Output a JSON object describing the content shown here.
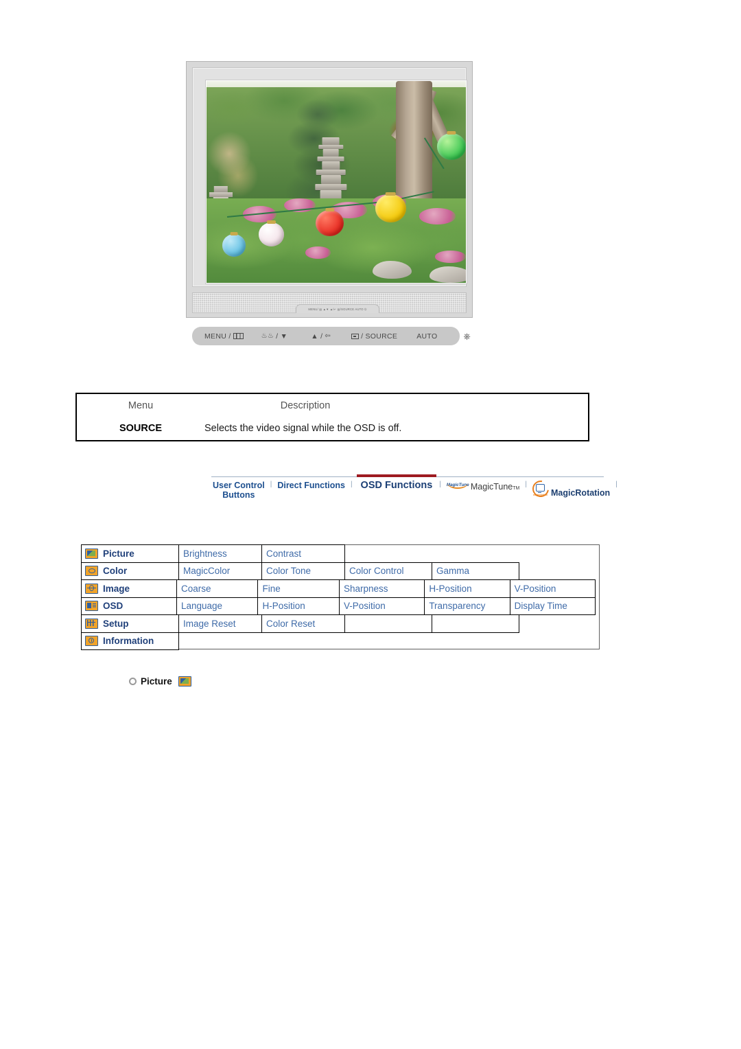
{
  "monitor": {
    "alt": "LCD monitor displaying a Korean temple garden with a stone pagoda and colorful paper lanterns",
    "base_strip_text": "MENU/ ▤  ▲▼  ▲/↵  ▤/SOURCE  AUTO  ⏻"
  },
  "buttons": [
    {
      "label": "MENU /",
      "icon": "menu-bars-icon"
    },
    {
      "label": "/ ▼",
      "icon": "magic-bright-icon"
    },
    {
      "label": "▲ /",
      "icon": "enter-arrow-icon"
    },
    {
      "label": "/ SOURCE",
      "icon": "source-box-icon"
    },
    {
      "label": "AUTO",
      "icon": ""
    },
    {
      "label": "",
      "icon": "power-icon"
    }
  ],
  "menu_table": {
    "headers": {
      "menu": "Menu",
      "description": "Description"
    },
    "rows": [
      {
        "menu": "SOURCE",
        "description": "Selects the video signal while the OSD is off."
      }
    ]
  },
  "nav": {
    "items": [
      {
        "label": "User Control Buttons",
        "line1": "User Control",
        "line2": "Buttons",
        "style": "stacked",
        "active": false
      },
      {
        "label": "Direct Functions",
        "style": "normal",
        "active": false
      },
      {
        "label": "OSD Functions",
        "style": "normal",
        "active": true
      },
      {
        "label": "MagicTune",
        "style": "logo",
        "icon": "magictune-logo-icon",
        "tm": "TM",
        "active": false
      },
      {
        "label": "MagicRotation",
        "style": "logo",
        "icon": "magicrotation-logo-icon",
        "active": false
      }
    ],
    "separator": "|",
    "active_underline_color": "#9e1b21",
    "link_color": "#1d4f8f"
  },
  "osd_table": {
    "rows": [
      {
        "icon": "picture-icon",
        "category": "Picture",
        "items": [
          "Brightness",
          "Contrast"
        ]
      },
      {
        "icon": "color-icon",
        "category": "Color",
        "items": [
          "MagicColor",
          "Color Tone",
          "Color Control",
          "Gamma"
        ]
      },
      {
        "icon": "image-icon",
        "category": "Image",
        "items": [
          "Coarse",
          "Fine",
          "Sharpness",
          "H-Position",
          "V-Position"
        ]
      },
      {
        "icon": "osd-icon",
        "category": "OSD",
        "items": [
          "Language",
          "H-Position",
          "V-Position",
          "Transparency",
          "Display Time"
        ]
      },
      {
        "icon": "setup-icon",
        "category": "Setup",
        "items": [
          "Image Reset",
          "Color Reset",
          "",
          ""
        ]
      },
      {
        "icon": "information-icon",
        "category": "Information",
        "items": []
      }
    ],
    "text_color": "#3f6ba8",
    "category_color": "#20407a"
  },
  "section_heading": {
    "bullet": "ring-bullet-icon",
    "label": "Picture",
    "icon": "picture-icon"
  }
}
